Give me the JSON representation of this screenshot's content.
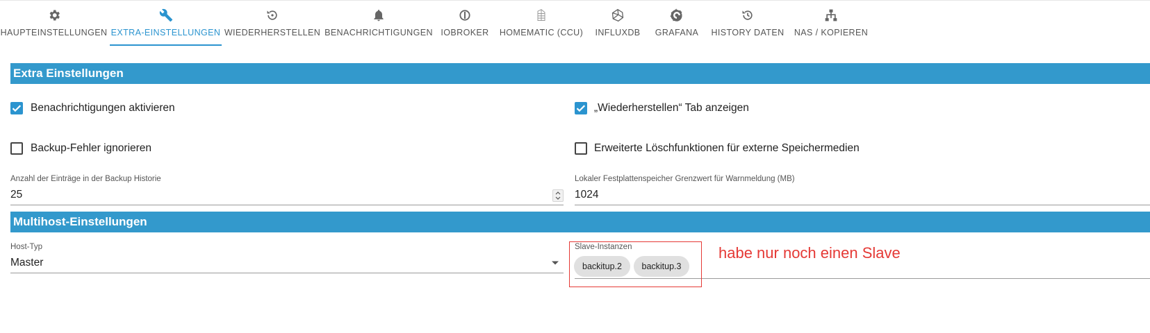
{
  "tabs": [
    {
      "label": "HAUPTEINSTELLUNGEN",
      "icon": "gear-icon"
    },
    {
      "label": "EXTRA-EINSTELLUNGEN",
      "icon": "wrench-icon",
      "active": true
    },
    {
      "label": "WIEDERHERSTELLEN",
      "icon": "restore-icon"
    },
    {
      "label": "BENACHRICHTIGUNGEN",
      "icon": "bell-icon"
    },
    {
      "label": "IOBROKER",
      "icon": "iobroker-icon"
    },
    {
      "label": "HOMEMATIC (CCU)",
      "icon": "homematic-icon"
    },
    {
      "label": "INFLUXDB",
      "icon": "influxdb-icon"
    },
    {
      "label": "GRAFANA",
      "icon": "grafana-icon"
    },
    {
      "label": "HISTORY DATEN",
      "icon": "history-icon"
    },
    {
      "label": "NAS / KOPIEREN",
      "icon": "network-icon"
    }
  ],
  "extra": {
    "title": "Extra Einstellungen",
    "notifications": {
      "label": "Benachrichtigungen aktivieren",
      "checked": true
    },
    "restore_tab": {
      "label": "„Wiederherstellen“ Tab anzeigen",
      "checked": true
    },
    "ignore_errors": {
      "label": "Backup-Fehler ignorieren",
      "checked": false
    },
    "extended_delete": {
      "label": "Erweiterte Löschfunktionen für externe Speichermedien",
      "checked": false
    },
    "history_entries": {
      "label": "Anzahl der Einträge in der Backup Historie",
      "value": "25"
    },
    "disk_threshold": {
      "label": "Lokaler Festplattenspeicher Grenzwert für Warnmeldung (MB)",
      "value": "1024"
    }
  },
  "multihost": {
    "title": "Multihost-Einstellungen",
    "host_type": {
      "label": "Host-Typ",
      "value": "Master"
    },
    "slaves": {
      "label": "Slave-Instanzen",
      "chips": [
        "backitup.2",
        "backitup.3"
      ]
    }
  },
  "annotation": {
    "text": "habe nur noch einen Slave",
    "color": "#e53935"
  },
  "colors": {
    "accent": "#2b94cf",
    "section": "#3399cc"
  }
}
